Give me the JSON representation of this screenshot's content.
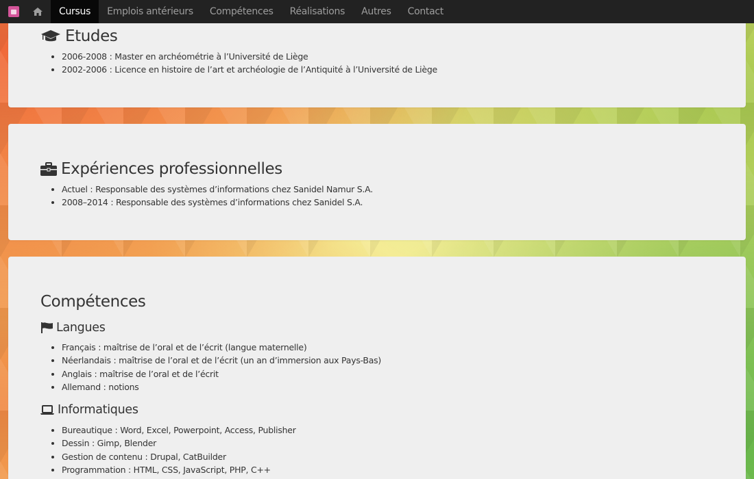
{
  "nav": {
    "items": [
      {
        "label": "Cursus",
        "active": true
      },
      {
        "label": "Emplois antérieurs",
        "active": false
      },
      {
        "label": "Compétences",
        "active": false
      },
      {
        "label": "Réalisations",
        "active": false
      },
      {
        "label": "Autres",
        "active": false
      },
      {
        "label": "Contact",
        "active": false
      }
    ]
  },
  "etudes": {
    "title": "Etudes",
    "icon": "graduation-cap-icon",
    "items": [
      "2006-2008 : Master en archéométrie à l’Université de Liège",
      "2002-2006 : Licence en histoire de l’art et archéologie de l’Antiquité à l’Université de Liège"
    ]
  },
  "experiences": {
    "title": "Expériences professionnelles",
    "icon": "briefcase-icon",
    "items": [
      "Actuel : Responsable des systèmes d’informations chez Sanidel Namur S.A.",
      "2008–2014 : Responsable des systèmes d’informations chez Sanidel S.A."
    ]
  },
  "competences": {
    "title": "Compétences",
    "langues": {
      "title": "Langues",
      "icon": "flag-icon",
      "items": [
        "Français : maîtrise de l’oral et de l’écrit (langue maternelle)",
        "Néerlandais : maîtrise de l’oral et de l’écrit (un an d’immersion aux Pays-Bas)",
        "Anglais : maîtrise de l’oral et de l’écrit",
        "Allemand : notions"
      ]
    },
    "informatiques": {
      "title": "Informatiques",
      "icon": "laptop-icon",
      "items": [
        "Bureautique : Word, Excel, Powerpoint, Access, Publisher",
        "Dessin : Gimp, Blender",
        "Gestion de contenu : Drupal, CatBuilder",
        "Programmation : HTML, CSS, JavaScript, PHP, C++"
      ]
    }
  },
  "colors": {
    "navbar": "#222222",
    "nav_active": "#080808",
    "card": "#efefef",
    "text": "#333333",
    "brand": "#d4559a"
  }
}
